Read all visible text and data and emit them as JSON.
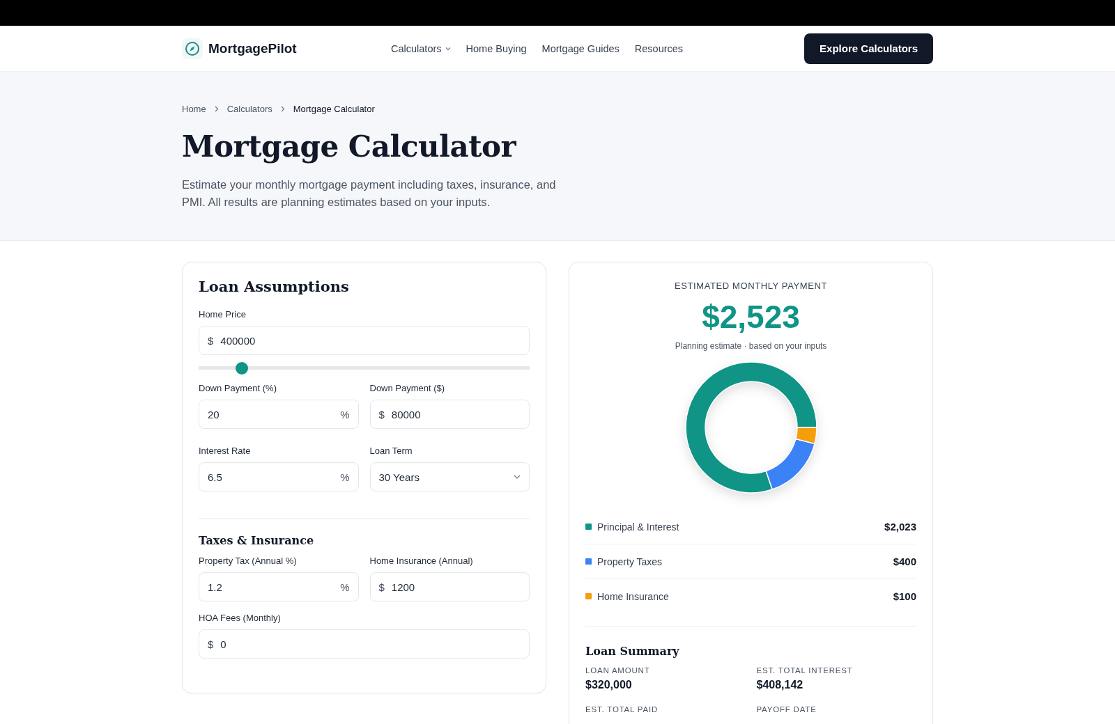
{
  "brand": {
    "name": "MortgagePilot"
  },
  "nav": [
    {
      "label": "Calculators",
      "dropdown": true
    },
    {
      "label": "Home Buying",
      "dropdown": false
    },
    {
      "label": "Mortgage Guides",
      "dropdown": false
    },
    {
      "label": "Resources",
      "dropdown": false
    }
  ],
  "cta": "Explore Calculators",
  "breadcrumb": [
    "Home",
    "Calculators",
    "Mortgage Calculator"
  ],
  "title": "Mortgage Calculator",
  "intro": "Estimate your monthly mortgage payment including taxes, insurance, and PMI. All results are planning estimates based on your inputs.",
  "loan_assumptions": {
    "title": "Loan Assumptions",
    "home_price": {
      "label": "Home Price",
      "prefix": "$",
      "value": "400000",
      "level": 0.13
    },
    "fields": [
      {
        "label": "Down Payment (%)",
        "kind": "suffix",
        "affix": "%",
        "value": "20"
      },
      {
        "label": "Down Payment ($)",
        "kind": "prefix",
        "affix": "$",
        "value": "80000"
      },
      {
        "label": "Interest Rate",
        "kind": "suffix",
        "affix": "%",
        "value": "6.5"
      },
      {
        "label": "Loan Term",
        "kind": "select",
        "value": "30 Years"
      }
    ]
  },
  "taxes_insurance": {
    "title": "Taxes & Insurance",
    "fields": [
      {
        "label": "Property Tax (Annual %)",
        "kind": "suffix",
        "affix": "%",
        "value": "1.2"
      },
      {
        "label": "Home Insurance (Annual)",
        "kind": "prefix",
        "affix": "$",
        "value": "1200"
      }
    ],
    "hoa": {
      "label": "HOA Fees (Monthly)",
      "prefix": "$",
      "value": "0"
    }
  },
  "result": {
    "label": "ESTIMATED MONTHLY PAYMENT",
    "amount": "$2,523",
    "note": "Planning estimate · based on your inputs",
    "chart_data": {
      "type": "donut",
      "categories": [
        "Principal & Interest",
        "Property Taxes",
        "Home Insurance"
      ],
      "values": [
        80.2,
        15.8,
        4.0
      ]
    },
    "breakdown": [
      {
        "value": "$2,023",
        "color": "#0f9485"
      },
      {
        "value": "$400",
        "color": "#3b82f6"
      },
      {
        "value": "$100",
        "color": "#f59e0b"
      }
    ]
  },
  "loan_summary": {
    "title": "Loan Summary",
    "items": [
      {
        "label": "LOAN AMOUNT",
        "value": "$320,000"
      },
      {
        "label": "EST. TOTAL INTEREST",
        "value": "$408,142"
      },
      {
        "label": "EST. TOTAL PAID"
      },
      {
        "label": "PAYOFF DATE"
      }
    ]
  }
}
